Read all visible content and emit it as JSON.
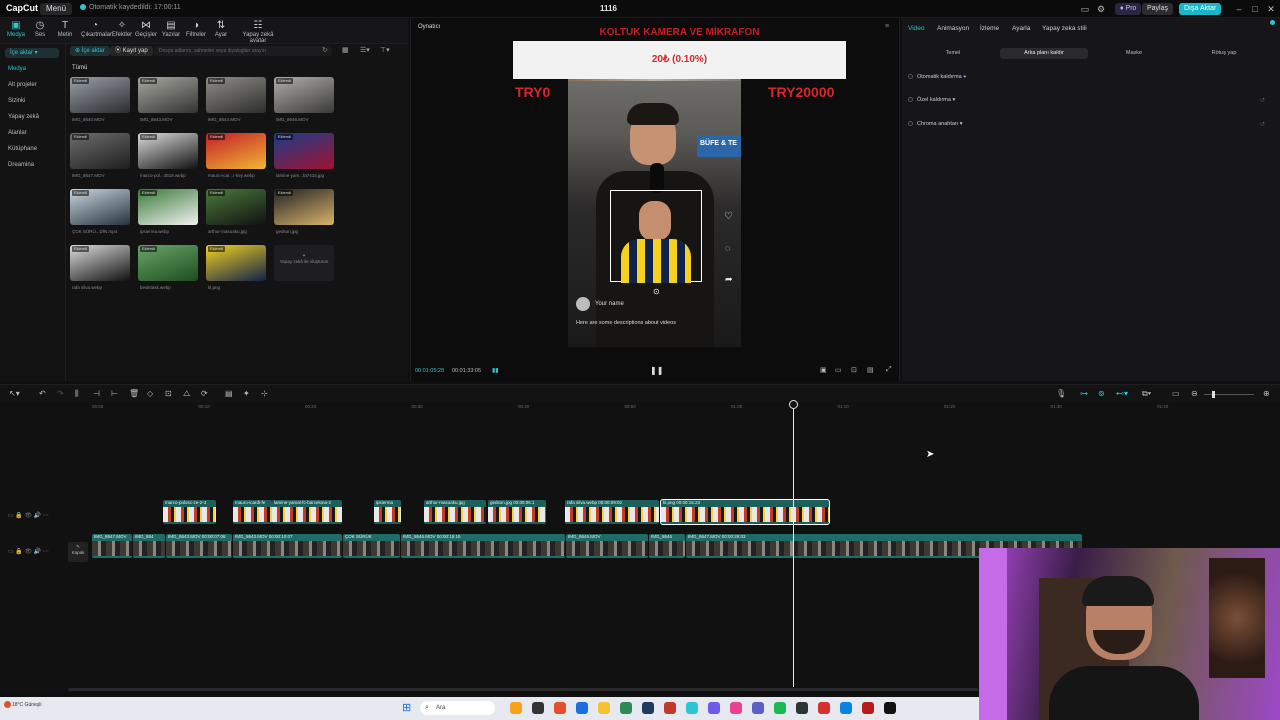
{
  "titlebar": {
    "logo": "CapCut",
    "menu": "Menü",
    "saved_status": "Otomatik kaydedildi: 17:00:11",
    "project_name": "1116",
    "pro": "Pro",
    "share": "Paylaş",
    "upgrade": "Dışa Aktar"
  },
  "toolbar": {
    "items": [
      {
        "label": "Medya",
        "icon": "media-icon"
      },
      {
        "label": "Ses",
        "icon": "audio-icon"
      },
      {
        "label": "Metin",
        "icon": "text-icon"
      },
      {
        "label": "Çıkartmalar",
        "icon": "sticker-icon"
      },
      {
        "label": "Efektler",
        "icon": "effects-icon"
      },
      {
        "label": "Geçişler",
        "icon": "transition-icon"
      },
      {
        "label": "Yazılar",
        "icon": "captions-icon"
      },
      {
        "label": "Filtreler",
        "icon": "filters-icon"
      },
      {
        "label": "Ayar",
        "icon": "adjust-icon"
      },
      {
        "label": "Yapay zekâ avatar",
        "icon": "avatar-icon"
      }
    ]
  },
  "leftnav": {
    "import": "İçe aktar",
    "items": [
      "Medya",
      "Alt projeler",
      "Sizinki",
      "Yapay zekâ",
      "Alanlar",
      "Kütüphane",
      "Dreamina"
    ]
  },
  "media": {
    "import_btn": "İçe aktar",
    "record_btn": "Kayıt yap",
    "search_placeholder": "Dosya adlarını, sahneleri veya diyalogları arayın",
    "all_tab": "Tümü",
    "added_tag": "Eklendi",
    "items": [
      {
        "label": "IMG_8640.MOV",
        "colors": [
          "#9aa0a8",
          "#2b2b30"
        ]
      },
      {
        "label": "IMG_8643.MOV",
        "colors": [
          "#a8a8a0",
          "#333"
        ]
      },
      {
        "label": "IMG_8644.MOV",
        "colors": [
          "#8f8d86",
          "#2d2d2d"
        ]
      },
      {
        "label": "IMG_8646.MOV",
        "colors": [
          "#b0aea8",
          "#3a3a3a"
        ]
      },
      {
        "label": "IMG_8647.MOV",
        "colors": [
          "#6e6e6e",
          "#1e1e1e"
        ]
      },
      {
        "label": "marco-pol...4518.webp",
        "colors": [
          "#ddd",
          "#111"
        ]
      },
      {
        "label": "mauro-icar...r-key.webp",
        "colors": [
          "#c21e2a",
          "#f2b632"
        ]
      },
      {
        "label": "lamine-yam...fa7415.jpg",
        "colors": [
          "#1a3e8a",
          "#a11230"
        ]
      },
      {
        "label": "ÇOK SÜRÜ...DİN.mp4",
        "colors": [
          "#c9d6e0",
          "#27343d"
        ]
      },
      {
        "label": "ipsierma.webp",
        "colors": [
          "#3a7a3a",
          "#f2f2f2"
        ]
      },
      {
        "label": "arthur-masuaku.jpg",
        "colors": [
          "#4b7b3b",
          "#111"
        ]
      },
      {
        "label": "gedson.jpg",
        "colors": [
          "#222",
          "#d9b36c"
        ]
      },
      {
        "label": "rafa silva.webp",
        "colors": [
          "#ddd",
          "#111"
        ]
      },
      {
        "label": "besiktask.webp",
        "colors": [
          "#6aa56a",
          "#1d4d1d"
        ]
      },
      {
        "label": "kl.png",
        "colors": [
          "#f4d21f",
          "#11224a"
        ]
      }
    ],
    "ai_generate": "Yapay zekâ ile oluşturun"
  },
  "player": {
    "title": "Oynatıcı",
    "red_title": "KOLTUK KAMERA VE MİKRAFON",
    "amount": "20₺ (0.10%)",
    "try_left": "TRY0",
    "try_right": "TRY20000",
    "sign_sticker": "BÜFE & TE",
    "name_placeholder": "Your name",
    "comment_placeholder": "Here are some descriptions about videos",
    "timecode": "00:01:05:28",
    "total": "00:01:33:05"
  },
  "rightpanel": {
    "tabs": [
      "Video",
      "Animasyon",
      "İzleme",
      "Ayarla",
      "Yapay zeka stili"
    ],
    "subtabs": [
      "Temel",
      "Arka planı kaldır",
      "Maske",
      "Rötuş yap"
    ],
    "options": [
      "Otomatik kaldırma",
      "Özel kaldırma",
      "Chroma anahtarı"
    ]
  },
  "timeline": {
    "ticks": [
      "00:00",
      "00:10",
      "00:20",
      "00:30",
      "00:40",
      "00:50",
      "01:00",
      "01:10",
      "01:20",
      "01:30",
      "01:40"
    ],
    "overlay_clips": [
      {
        "name": "marco-polosc-ze-2-3",
        "start": 163,
        "end": 216
      },
      {
        "name": "mauro-icardi-fe",
        "start": 233,
        "end": 272
      },
      {
        "name": "lamine-yamal-fc-barcelona-2",
        "start": 272,
        "end": 342
      },
      {
        "name": "ipsierma",
        "start": 374,
        "end": 401
      },
      {
        "name": "arthur-masuaku.jpg",
        "start": 424,
        "end": 486
      },
      {
        "name": "gedson.jpg 00:00:05:1",
        "start": 488,
        "end": 546
      },
      {
        "name": "rafa silva.webp 00:00:09:02",
        "start": 565,
        "end": 659
      },
      {
        "name": "kl.png 00:00:15:23",
        "start": 661,
        "end": 829
      }
    ],
    "main_clips": [
      {
        "name": "IMG_8647.MOV",
        "start": 92,
        "end": 132
      },
      {
        "name": "IMG_864",
        "start": 133,
        "end": 165
      },
      {
        "name": "IMG_8643.MOV 00:00:07:06",
        "start": 166,
        "end": 232
      },
      {
        "name": "IMG_8643.MOV 00:00:10:07",
        "start": 233,
        "end": 342
      },
      {
        "name": "ÇOK SÜRÜK",
        "start": 343,
        "end": 400
      },
      {
        "name": "IMG_8646.MOV 00:00:15:15",
        "start": 401,
        "end": 565
      },
      {
        "name": "IMG_8646.MOV",
        "start": 566,
        "end": 648
      },
      {
        "name": "IMG_8646",
        "start": 649,
        "end": 685
      },
      {
        "name": "IMG_8647.MOV 00:00:26:03",
        "start": 686,
        "end": 1082
      }
    ],
    "cover_label": "Kapak"
  },
  "taskbar": {
    "weather": "18°C Güneşli",
    "search": "Ara"
  },
  "colors": {
    "accent": "#2ec5d3",
    "clip_teal": "#1f6b67"
  }
}
